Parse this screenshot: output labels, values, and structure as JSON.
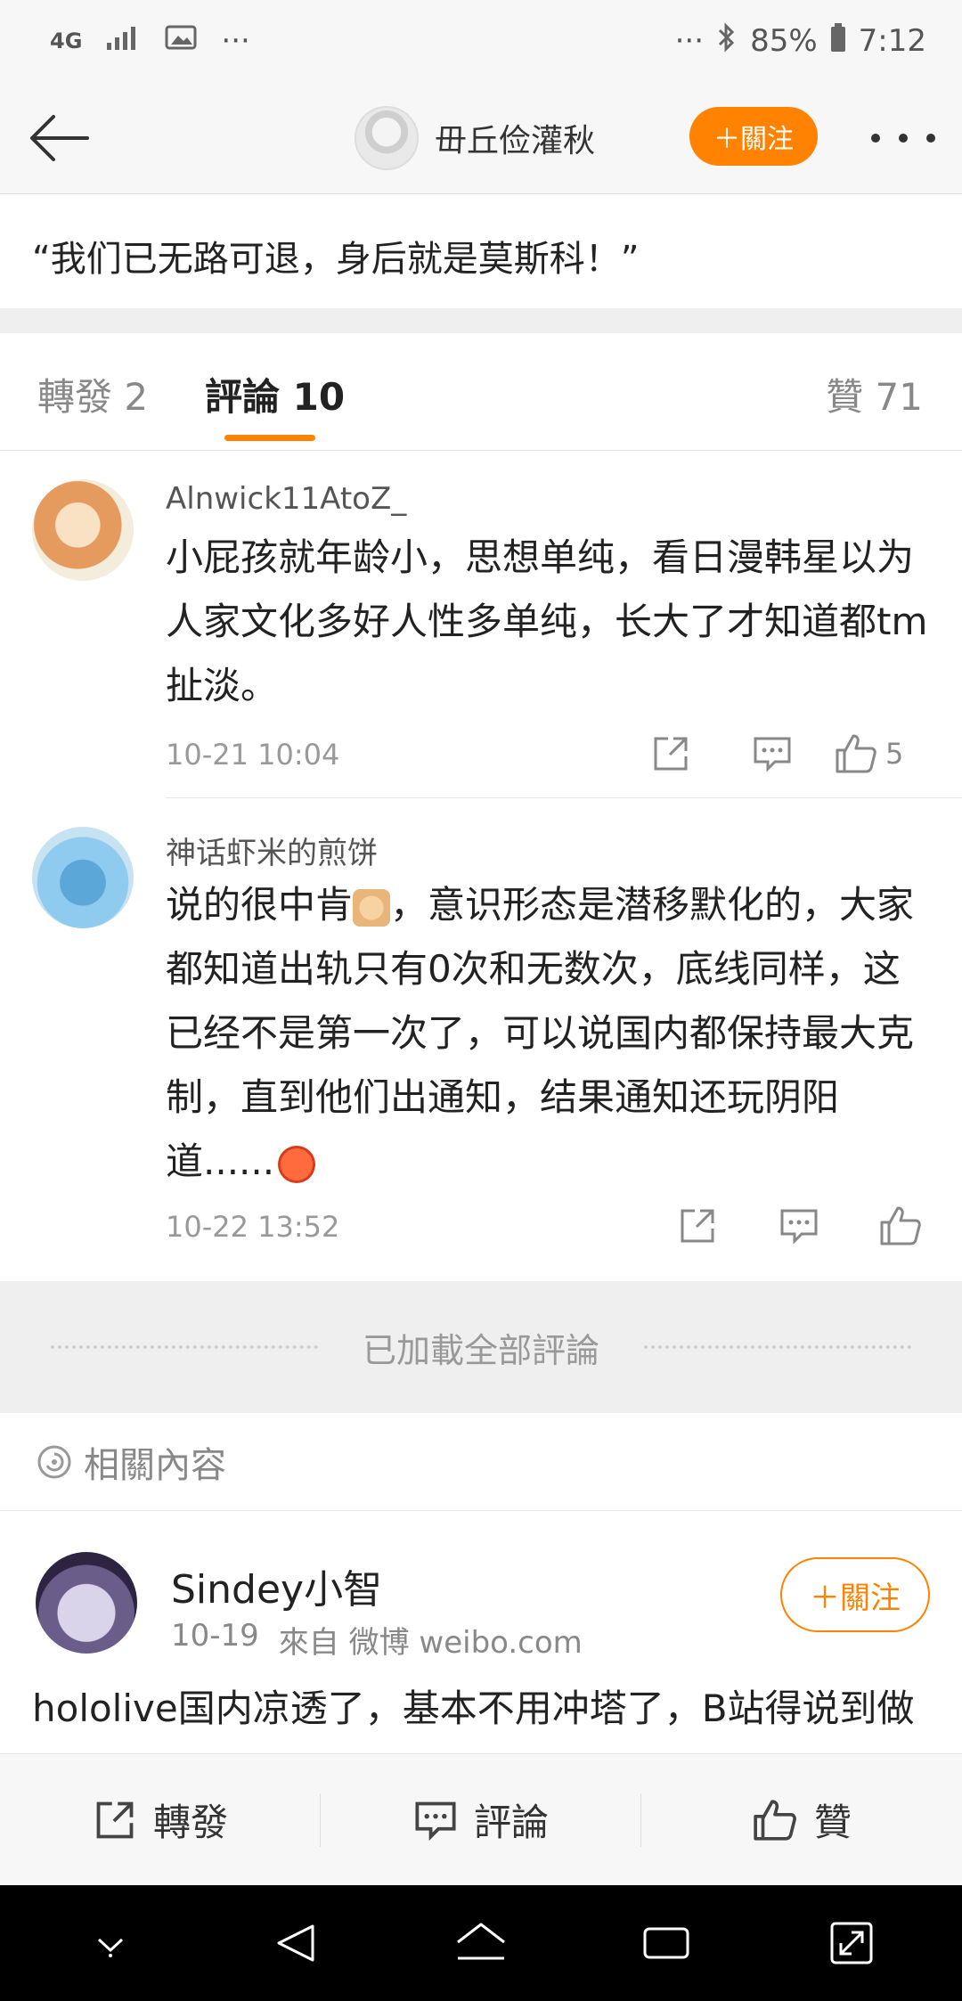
{
  "status_bar": {
    "network": "4G",
    "more_left": "···",
    "more_right": "···",
    "battery": "85%",
    "time": "7:12"
  },
  "nav": {
    "username": "毌丘俭灌秋",
    "follow_label": "＋關注"
  },
  "quote": "“我们已无路可退，身后就是莫斯科！”",
  "tabs": {
    "repost": "轉發 2",
    "comments": "評論 10",
    "likes": "贊 71"
  },
  "comments": [
    {
      "name": "Alnwick11AtoZ_",
      "text": "小屁孩就年龄小，思想单纯，看日漫韩星以为人家文化多好人性多单纯，长大了才知道都tm扯淡。",
      "time": "10-21 10:04",
      "like_count": "5"
    },
    {
      "name": "神话虾米的煎饼",
      "text_part1": "说的很中肯",
      "text_part2": "，意识形态是潜移默化的，大家都知道出轨只有0次和无数次，底线同样，这已经不是第一次了，可以说国内都保持最大克制，直到他们出通知，结果通知还玩阴阳道......",
      "time": "10-22 13:52"
    }
  ],
  "loaded_text": "已加載全部評論",
  "related_label": "相關內容",
  "related_card": {
    "name": "Sindey小智",
    "date": "10-19",
    "source": "來自 微博 weibo.com",
    "follow_label": "＋關注",
    "text": "hololive国内凉透了，基本不用冲塔了，B站得说到做到，完全清理干净啊，随那帮守他去，以后只要"
  },
  "bottom_bar": {
    "repost": "轉發",
    "comment": "評論",
    "like": "贊"
  },
  "colors": {
    "accent": "#ff8200",
    "background_gray": "#efefef"
  }
}
